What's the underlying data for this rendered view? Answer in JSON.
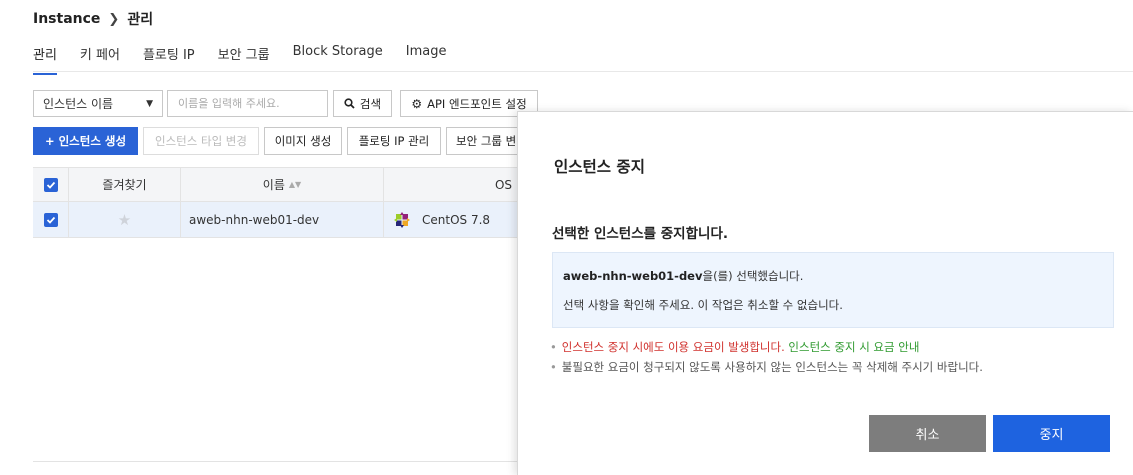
{
  "breadcrumb": {
    "root": "Instance",
    "separator": "chevron-right-icon",
    "current": "관리"
  },
  "tabs": [
    {
      "label": "관리",
      "active": true
    },
    {
      "label": "키 페어",
      "active": false
    },
    {
      "label": "플로팅 IP",
      "active": false
    },
    {
      "label": "보안 그룹",
      "active": false
    },
    {
      "label": "Block Storage",
      "active": false
    },
    {
      "label": "Image",
      "active": false
    }
  ],
  "search": {
    "select_value": "인스턴스 이름",
    "placeholder": "이름을 입력해 주세요.",
    "search_button": "검색",
    "api_button": "API 엔드포인트 설정"
  },
  "toolbar": {
    "create": "+ 인스턴스 생성",
    "change_type": "인스턴스 타입 변경",
    "create_image": "이미지 생성",
    "floating_ip": "플로팅 IP 관리",
    "security_group": "보안 그룹 변경"
  },
  "table": {
    "headers": {
      "favorite": "즐겨찾기",
      "name": "이름",
      "os": "OS"
    },
    "rows": [
      {
        "name": "aweb-nhn-web01-dev",
        "os": "CentOS 7.8",
        "checked": true
      }
    ]
  },
  "modal": {
    "title": "인스턴스 중지",
    "subtitle": "선택한 인스턴스를 중지합니다.",
    "selected_name": "aweb-nhn-web01-dev",
    "selected_suffix": "을(를) 선택했습니다.",
    "confirm_text": "선택 사항을 확인해 주세요. 이 작업은 취소할 수 없습니다.",
    "note1_warning": "인스턴스 중지 시에도 이용 요금이 발생합니다.",
    "note1_link": "인스턴스 중지 시 요금 안내",
    "note2": "불필요한 요금이 청구되지 않도록 사용하지 않는 인스턴스는 꼭 삭제해 주시기 바랍니다.",
    "cancel": "취소",
    "stop": "중지"
  },
  "colors": {
    "primary": "#2a63d6",
    "stop_button": "#1e63e0",
    "cancel_button": "#7d7d7d",
    "warning": "#d0312d",
    "link": "#2f9a2f"
  }
}
